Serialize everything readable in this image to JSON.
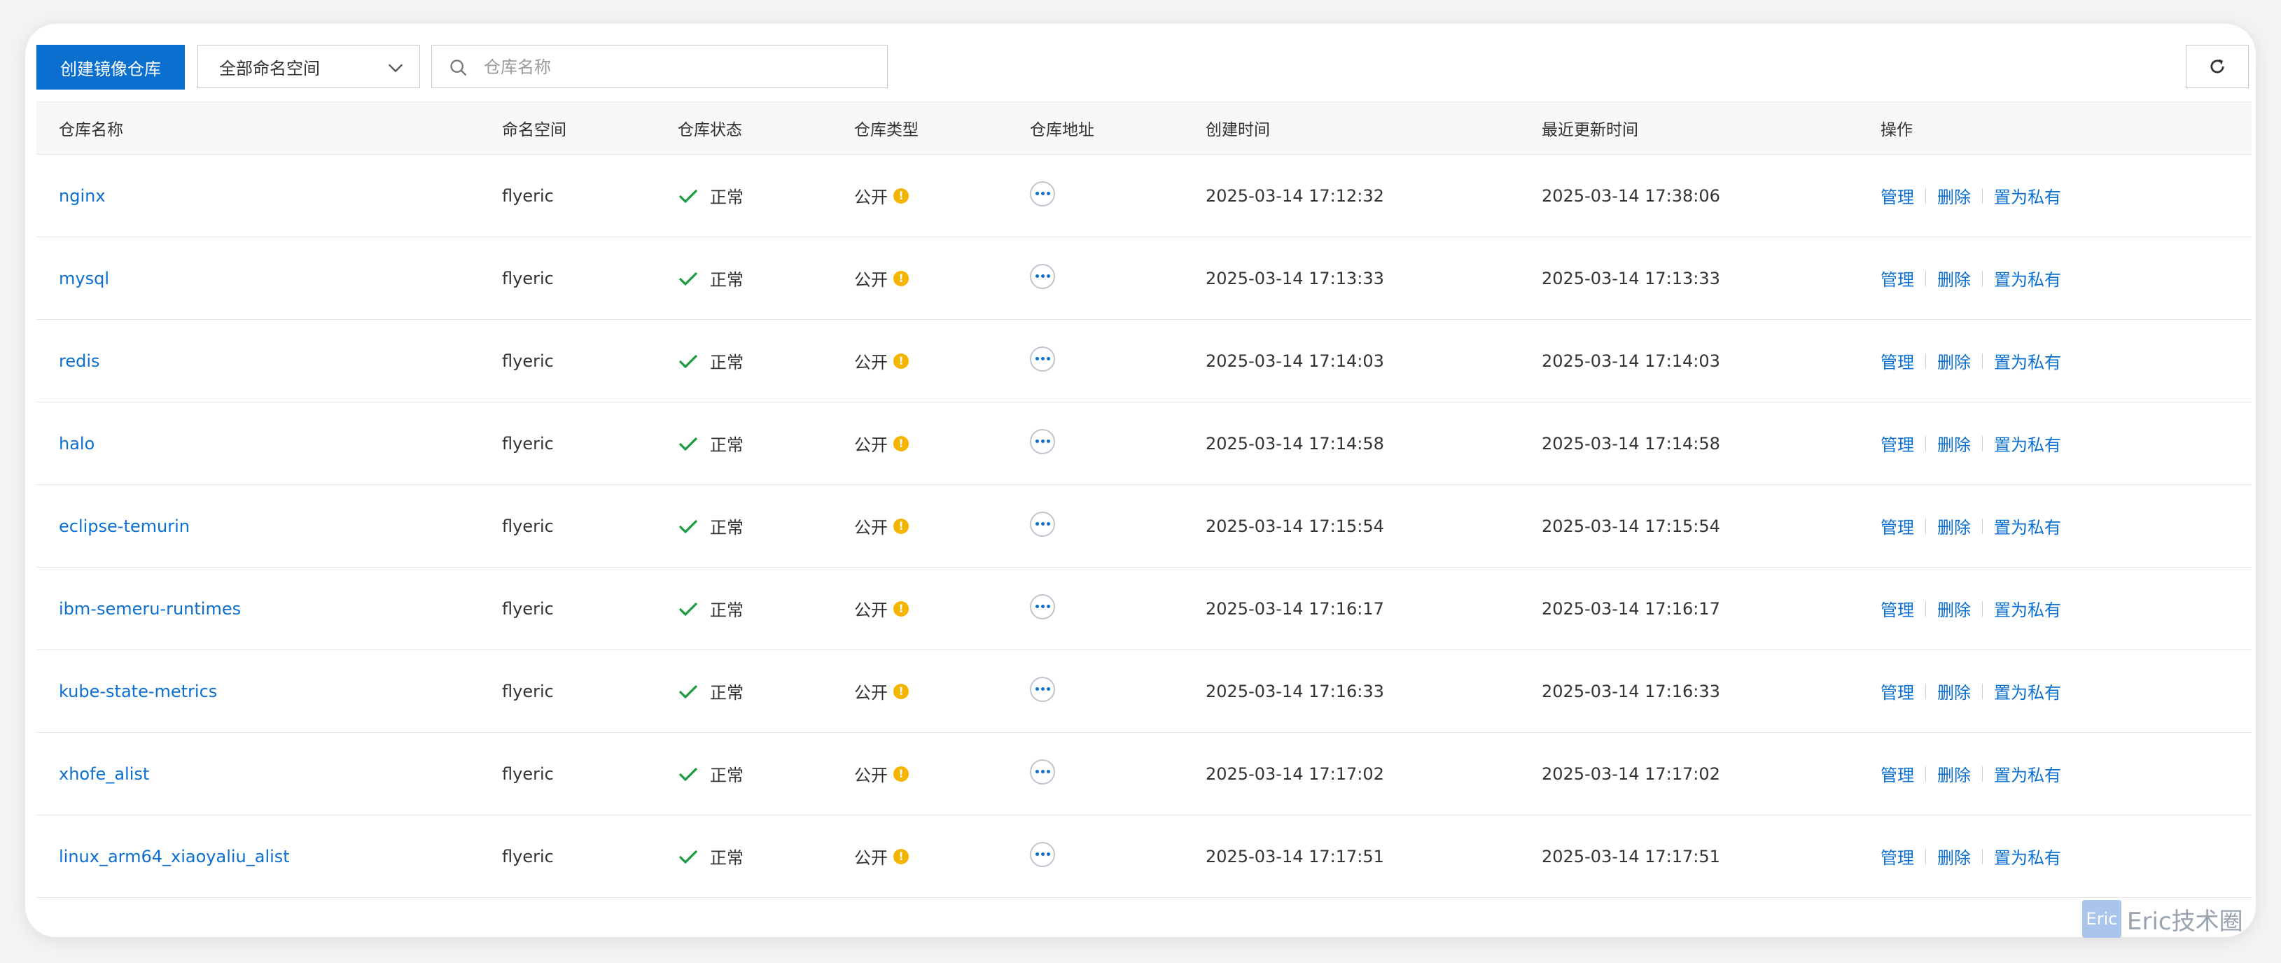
{
  "toolbar": {
    "create_label": "创建镜像仓库",
    "namespace_select": "全部命名空间",
    "search_placeholder": "仓库名称"
  },
  "table": {
    "headers": [
      "仓库名称",
      "命名空间",
      "仓库状态",
      "仓库类型",
      "仓库地址",
      "创建时间",
      "最近更新时间",
      "操作"
    ],
    "rows": [
      {
        "name": "nginx",
        "namespace": "flyeric",
        "status": "正常",
        "type": "公开",
        "created": "2025-03-14 17:12:32",
        "updated": "2025-03-14 17:38:06"
      },
      {
        "name": "mysql",
        "namespace": "flyeric",
        "status": "正常",
        "type": "公开",
        "created": "2025-03-14 17:13:33",
        "updated": "2025-03-14 17:13:33"
      },
      {
        "name": "redis",
        "namespace": "flyeric",
        "status": "正常",
        "type": "公开",
        "created": "2025-03-14 17:14:03",
        "updated": "2025-03-14 17:14:03"
      },
      {
        "name": "halo",
        "namespace": "flyeric",
        "status": "正常",
        "type": "公开",
        "created": "2025-03-14 17:14:58",
        "updated": "2025-03-14 17:14:58"
      },
      {
        "name": "eclipse-temurin",
        "namespace": "flyeric",
        "status": "正常",
        "type": "公开",
        "created": "2025-03-14 17:15:54",
        "updated": "2025-03-14 17:15:54"
      },
      {
        "name": "ibm-semeru-runtimes",
        "namespace": "flyeric",
        "status": "正常",
        "type": "公开",
        "created": "2025-03-14 17:16:17",
        "updated": "2025-03-14 17:16:17"
      },
      {
        "name": "kube-state-metrics",
        "namespace": "flyeric",
        "status": "正常",
        "type": "公开",
        "created": "2025-03-14 17:16:33",
        "updated": "2025-03-14 17:16:33"
      },
      {
        "name": "xhofe_alist",
        "namespace": "flyeric",
        "status": "正常",
        "type": "公开",
        "created": "2025-03-14 17:17:02",
        "updated": "2025-03-14 17:17:02"
      },
      {
        "name": "linux_arm64_xiaoyaliu_alist",
        "namespace": "flyeric",
        "status": "正常",
        "type": "公开",
        "created": "2025-03-14 17:17:51",
        "updated": "2025-03-14 17:17:51"
      }
    ],
    "actions": {
      "manage": "管理",
      "delete": "删除",
      "make_private": "置为私有"
    }
  },
  "colors": {
    "primary": "#0b6fd0",
    "success": "#1a9c3e",
    "warning": "#f5b400"
  },
  "watermark": {
    "logo": "Eric",
    "text": "Eric技术圈"
  }
}
